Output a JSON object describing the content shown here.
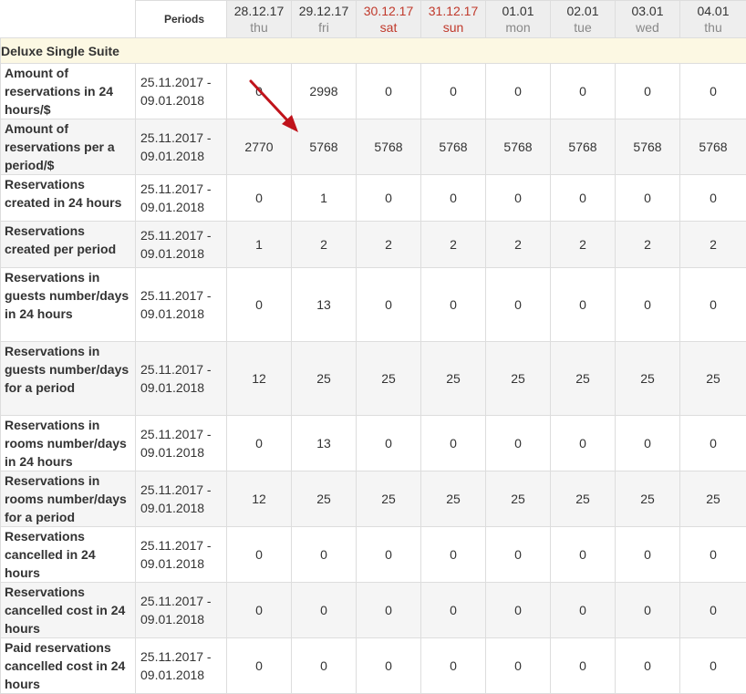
{
  "header": {
    "periods_label": "Periods",
    "dates": [
      {
        "date": "28.12.17",
        "day": "thu",
        "weekend": false
      },
      {
        "date": "29.12.17",
        "day": "fri",
        "weekend": false
      },
      {
        "date": "30.12.17",
        "day": "sat",
        "weekend": true
      },
      {
        "date": "31.12.17",
        "day": "sun",
        "weekend": true
      },
      {
        "date": "01.01",
        "day": "mon",
        "weekend": false
      },
      {
        "date": "02.01",
        "day": "tue",
        "weekend": false
      },
      {
        "date": "03.01",
        "day": "wed",
        "weekend": false
      },
      {
        "date": "04.01",
        "day": "thu",
        "weekend": false
      }
    ]
  },
  "section_title": "Deluxe Single Suite",
  "colors": {
    "weekend": "#c0392b",
    "annotation_arrow": "#c0131b",
    "section_background": "#fcf8e3"
  },
  "rows": [
    {
      "label": "Amount of reservations in 24 hours/$",
      "period": "25.11.2017 - 09.01.2018",
      "values": [
        "0",
        "2998",
        "0",
        "0",
        "0",
        "0",
        "0",
        "0"
      ]
    },
    {
      "label": "Amount of reservations per a period/$",
      "period": "25.11.2017 - 09.01.2018",
      "values": [
        "2770",
        "5768",
        "5768",
        "5768",
        "5768",
        "5768",
        "5768",
        "5768"
      ]
    },
    {
      "label": "Reservations created in 24 hours",
      "period": "25.11.2017 - 09.01.2018",
      "values": [
        "0",
        "1",
        "0",
        "0",
        "0",
        "0",
        "0",
        "0"
      ]
    },
    {
      "label": "Reservations created per period",
      "period": "25.11.2017 - 09.01.2018",
      "values": [
        "1",
        "2",
        "2",
        "2",
        "2",
        "2",
        "2",
        "2"
      ]
    },
    {
      "label": "Reservations in guests number/days in 24 hours",
      "period": "25.11.2017 - 09.01.2018",
      "values": [
        "0",
        "13",
        "0",
        "0",
        "0",
        "0",
        "0",
        "0"
      ]
    },
    {
      "label": "Reservations in guests number/days for a period",
      "period": "25.11.2017 - 09.01.2018",
      "values": [
        "12",
        "25",
        "25",
        "25",
        "25",
        "25",
        "25",
        "25"
      ]
    },
    {
      "label": "Reservations in rooms number/days in 24 hours",
      "period": "25.11.2017 - 09.01.2018",
      "values": [
        "0",
        "13",
        "0",
        "0",
        "0",
        "0",
        "0",
        "0"
      ]
    },
    {
      "label": "Reservations in rooms number/days for a period",
      "period": "25.11.2017 - 09.01.2018",
      "values": [
        "12",
        "25",
        "25",
        "25",
        "25",
        "25",
        "25",
        "25"
      ]
    },
    {
      "label": "Reservations cancelled in 24 hours",
      "period": "25.11.2017 - 09.01.2018",
      "values": [
        "0",
        "0",
        "0",
        "0",
        "0",
        "0",
        "0",
        "0"
      ]
    },
    {
      "label": "Reservations cancelled cost in 24 hours",
      "period": "25.11.2017 - 09.01.2018",
      "values": [
        "0",
        "0",
        "0",
        "0",
        "0",
        "0",
        "0",
        "0"
      ]
    },
    {
      "label": "Paid reservations cancelled cost in 24 hours",
      "period": "25.11.2017 - 09.01.2018",
      "values": [
        "0",
        "0",
        "0",
        "0",
        "0",
        "0",
        "0",
        "0"
      ]
    }
  ]
}
